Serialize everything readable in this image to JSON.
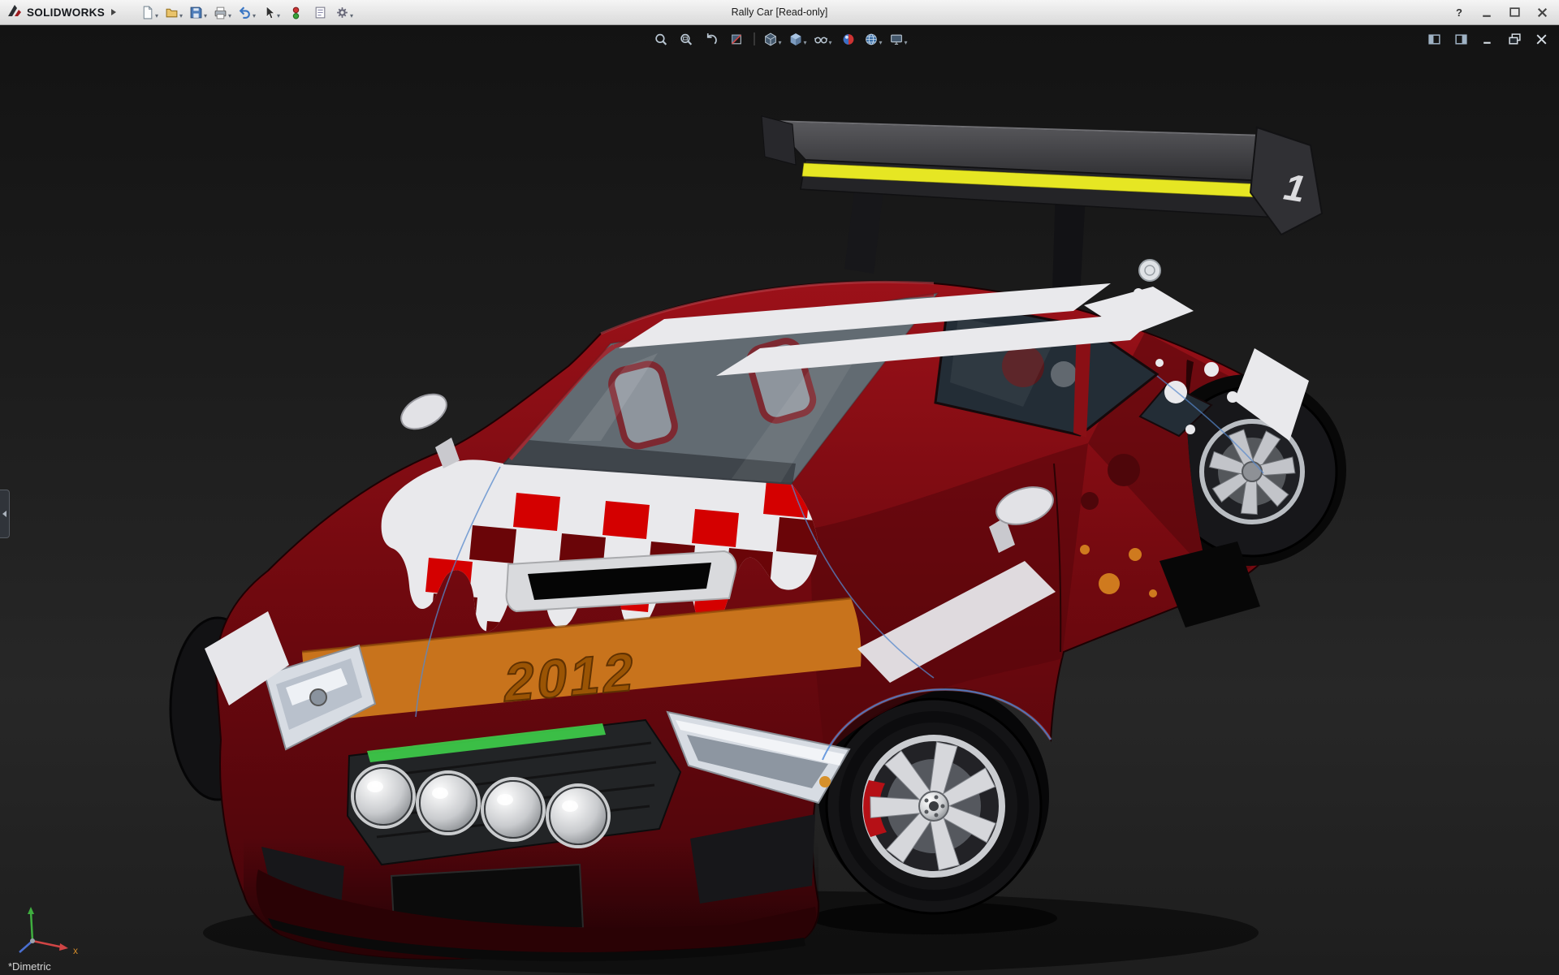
{
  "window": {
    "brand": "SOLIDWORKS",
    "title": "Rally Car [Read-only]",
    "controls": [
      {
        "name": "win-help",
        "glyph": "?"
      },
      {
        "name": "win-minimize"
      },
      {
        "name": "win-maximize"
      },
      {
        "name": "win-close"
      }
    ]
  },
  "main_toolbar": {
    "items": [
      {
        "name": "new",
        "dropdown": true
      },
      {
        "name": "open",
        "dropdown": true
      },
      {
        "name": "save",
        "dropdown": true
      },
      {
        "name": "print",
        "dropdown": true
      },
      {
        "name": "undo",
        "dropdown": true
      },
      {
        "name": "select",
        "dropdown": true
      },
      {
        "name": "rebuild",
        "dropdown": false
      },
      {
        "name": "file-properties",
        "dropdown": false
      },
      {
        "name": "options",
        "dropdown": true
      }
    ]
  },
  "viewport": {
    "hud": {
      "items": [
        {
          "name": "zoom-fit"
        },
        {
          "name": "zoom-area"
        },
        {
          "name": "previous-view"
        },
        {
          "name": "section-view"
        },
        {
          "name": "separator"
        },
        {
          "name": "view-orientation",
          "dropdown": true
        },
        {
          "name": "display-style",
          "dropdown": true
        },
        {
          "name": "hide-show-items",
          "dropdown": true
        },
        {
          "name": "edit-appearance"
        },
        {
          "name": "apply-scene",
          "dropdown": true
        },
        {
          "name": "view-settings",
          "dropdown": true
        }
      ]
    },
    "doc_controls": [
      {
        "name": "doc-maximize-left"
      },
      {
        "name": "doc-maximize-right"
      },
      {
        "name": "doc-minimize"
      },
      {
        "name": "doc-restore"
      },
      {
        "name": "doc-close"
      }
    ],
    "view_label": "*Dimetric",
    "triad": {
      "x_label": "x"
    }
  },
  "model": {
    "name": "Rally Car",
    "year_decal": "2012",
    "wing_number": "1",
    "colors": {
      "body_red": "#7a0c12",
      "accent_orange": "#c8731c",
      "stripe_white": "#e9e9ec",
      "wing_yellow": "#e6e623",
      "checker_red": "#d40000",
      "checker_maroon": "#6a0508"
    }
  }
}
